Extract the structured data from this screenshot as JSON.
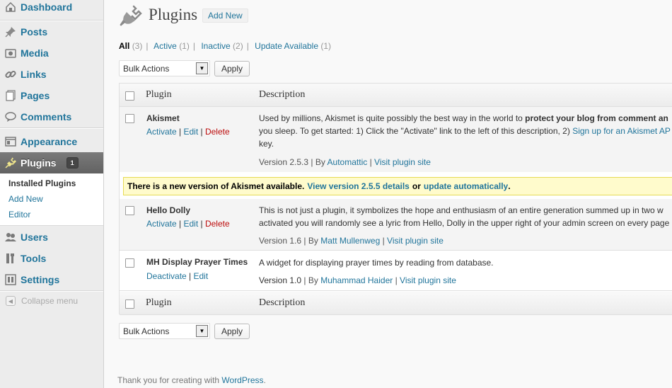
{
  "sidebar": {
    "items": [
      {
        "label": "Dashboard",
        "icon": "dashboard-icon"
      },
      {
        "label": "Posts",
        "icon": "pin-icon"
      },
      {
        "label": "Media",
        "icon": "media-icon"
      },
      {
        "label": "Links",
        "icon": "links-icon"
      },
      {
        "label": "Pages",
        "icon": "pages-icon"
      },
      {
        "label": "Comments",
        "icon": "comments-icon"
      },
      {
        "label": "Appearance",
        "icon": "appearance-icon"
      },
      {
        "label": "Plugins",
        "icon": "plugin-icon",
        "badge": "1"
      },
      {
        "label": "Users",
        "icon": "users-icon"
      },
      {
        "label": "Tools",
        "icon": "tools-icon"
      },
      {
        "label": "Settings",
        "icon": "settings-icon"
      }
    ],
    "submenu": [
      "Installed Plugins",
      "Add New",
      "Editor"
    ],
    "collapse_label": "Collapse menu"
  },
  "page": {
    "title": "Plugins",
    "add_new": "Add New"
  },
  "filters": [
    {
      "label": "All",
      "count": "(3)"
    },
    {
      "label": "Active",
      "count": "(1)"
    },
    {
      "label": "Inactive",
      "count": "(2)"
    },
    {
      "label": "Update Available",
      "count": "(1)"
    }
  ],
  "bulk": {
    "selected": "Bulk Actions",
    "apply": "Apply"
  },
  "table": {
    "col_plugin": "Plugin",
    "col_description": "Description",
    "rows": [
      {
        "name": "Akismet",
        "actions": [
          "Activate",
          "Edit",
          "Delete"
        ],
        "desc_line1_pre": "Used by millions, Akismet is quite possibly the best way in the world to ",
        "desc_line1_bold": "protect your blog from comment an",
        "desc_line2_pre": "you sleep. To get started: 1) Click the \"Activate\" link to the left of this description, 2) ",
        "desc_line2_link": "Sign up for an Akismet AP",
        "desc_line3": "key.",
        "version": "Version 2.5.3",
        "by": "By",
        "author": "Automattic",
        "visit": "Visit plugin site"
      },
      {
        "name": "Hello Dolly",
        "actions": [
          "Activate",
          "Edit",
          "Delete"
        ],
        "desc_line1": "This is not just a plugin, it symbolizes the hope and enthusiasm of an entire generation summed up in two w",
        "desc_line2": "activated you will randomly see a lyric from Hello, Dolly in the upper right of your admin screen on every page",
        "version": "Version 1.6",
        "by": "By",
        "author": "Matt Mullenweg",
        "visit": "Visit plugin site"
      },
      {
        "name": "MH Display Prayer Times",
        "actions": [
          "Deactivate",
          "Edit"
        ],
        "desc_line1": "A widget for displaying prayer times by reading from database.",
        "version": "Version 1.0",
        "by": "By",
        "author": "Muhammad Haider",
        "visit": "Visit plugin site"
      }
    ],
    "update_notice": {
      "text_pre": "There is a new version of Akismet available.",
      "link_details": "View version 2.5.5 details",
      "or": "or",
      "link_update": "update automatically",
      "end": "."
    }
  },
  "footer": {
    "pre": "Thank you for creating with ",
    "link": "WordPress",
    "end": "."
  },
  "colors": {
    "link": "#21759b",
    "delete": "#bc0b0b",
    "notice_bg": "#fffbcc",
    "active_menu": "#6d6d6d"
  }
}
